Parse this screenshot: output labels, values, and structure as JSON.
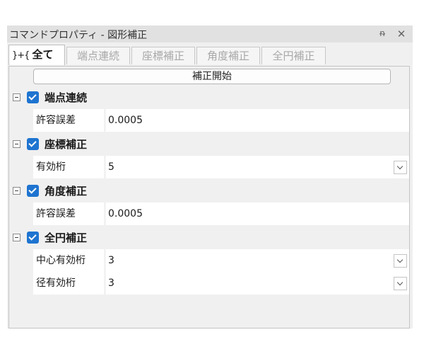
{
  "window": {
    "title": "コマンドプロパティ - 図形補正",
    "pin_icon": "pin-icon",
    "close_icon": "close-icon"
  },
  "tabs": [
    {
      "label": "全て",
      "icon": "fit-arrows-icon",
      "active": true
    },
    {
      "label": "端点連続",
      "active": false
    },
    {
      "label": "座標補正",
      "active": false
    },
    {
      "label": "角度補正",
      "active": false
    },
    {
      "label": "全円補正",
      "active": false
    }
  ],
  "start_button": {
    "label": "補正開始"
  },
  "sections": [
    {
      "label": "端点連続",
      "checked": true,
      "properties": [
        {
          "name": "許容誤差",
          "value": "0.0005"
        }
      ]
    },
    {
      "label": "座標補正",
      "checked": true,
      "properties": [
        {
          "name": "有効桁",
          "value": "5",
          "dropdown": true
        }
      ]
    },
    {
      "label": "角度補正",
      "checked": true,
      "properties": [
        {
          "name": "許容誤差",
          "value": "0.0005"
        }
      ]
    },
    {
      "label": "全円補正",
      "checked": true,
      "properties": [
        {
          "name": "中心有効桁",
          "value": "3",
          "dropdown": true
        },
        {
          "name": "径有効桁",
          "value": "3",
          "dropdown": true
        }
      ]
    }
  ]
}
